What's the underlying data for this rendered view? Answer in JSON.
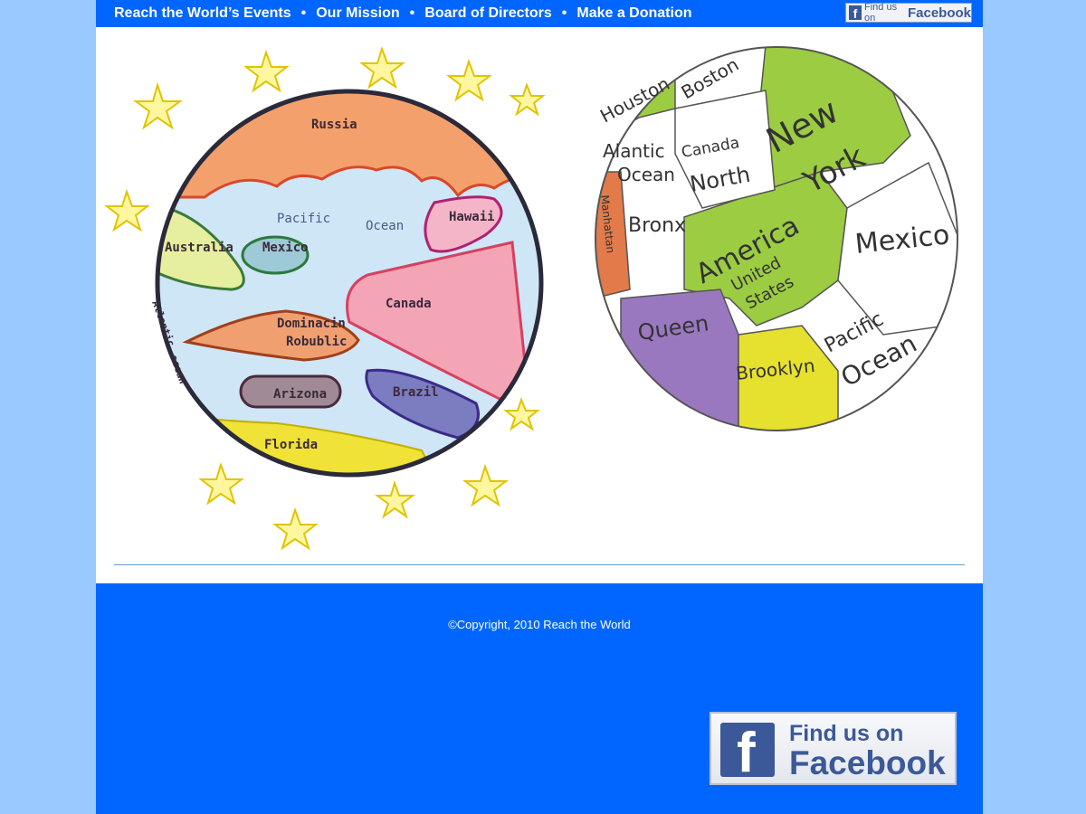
{
  "nav": {
    "links": [
      "Reach the World’s Events",
      "Our Mission",
      "Board of Directors",
      "Make a Donation"
    ],
    "separator": "•"
  },
  "facebook_badge_small": {
    "line1": "Find us on",
    "line2": "Facebook",
    "logo": "f"
  },
  "drawing1": {
    "labels": [
      "Russia",
      "Pacific",
      "Ocean",
      "Hawaii",
      "Australia",
      "Mexico",
      "Canada",
      "Dominacin",
      "Robublic",
      "Atlantic",
      "ocean",
      "Arizona",
      "Brazil",
      "Florida"
    ]
  },
  "drawing2": {
    "labels": [
      "Houston",
      "Boston",
      "Alantic",
      "Ocean",
      "Canada",
      "North",
      "New",
      "York",
      "Manhattan",
      "Bronx",
      "America",
      "United",
      "States",
      "Mexico",
      "Queen",
      "Pacific",
      "Ocean",
      "Brooklyn"
    ]
  },
  "footer": {
    "copyright": "©Copyright, 2010 Reach the World"
  },
  "facebook_badge_large": {
    "line1": "Find us on",
    "line2": "Facebook",
    "logo": "f"
  },
  "colors": {
    "brand_blue": "#0066ff",
    "background": "#99c9ff",
    "facebook": "#3b5998"
  }
}
